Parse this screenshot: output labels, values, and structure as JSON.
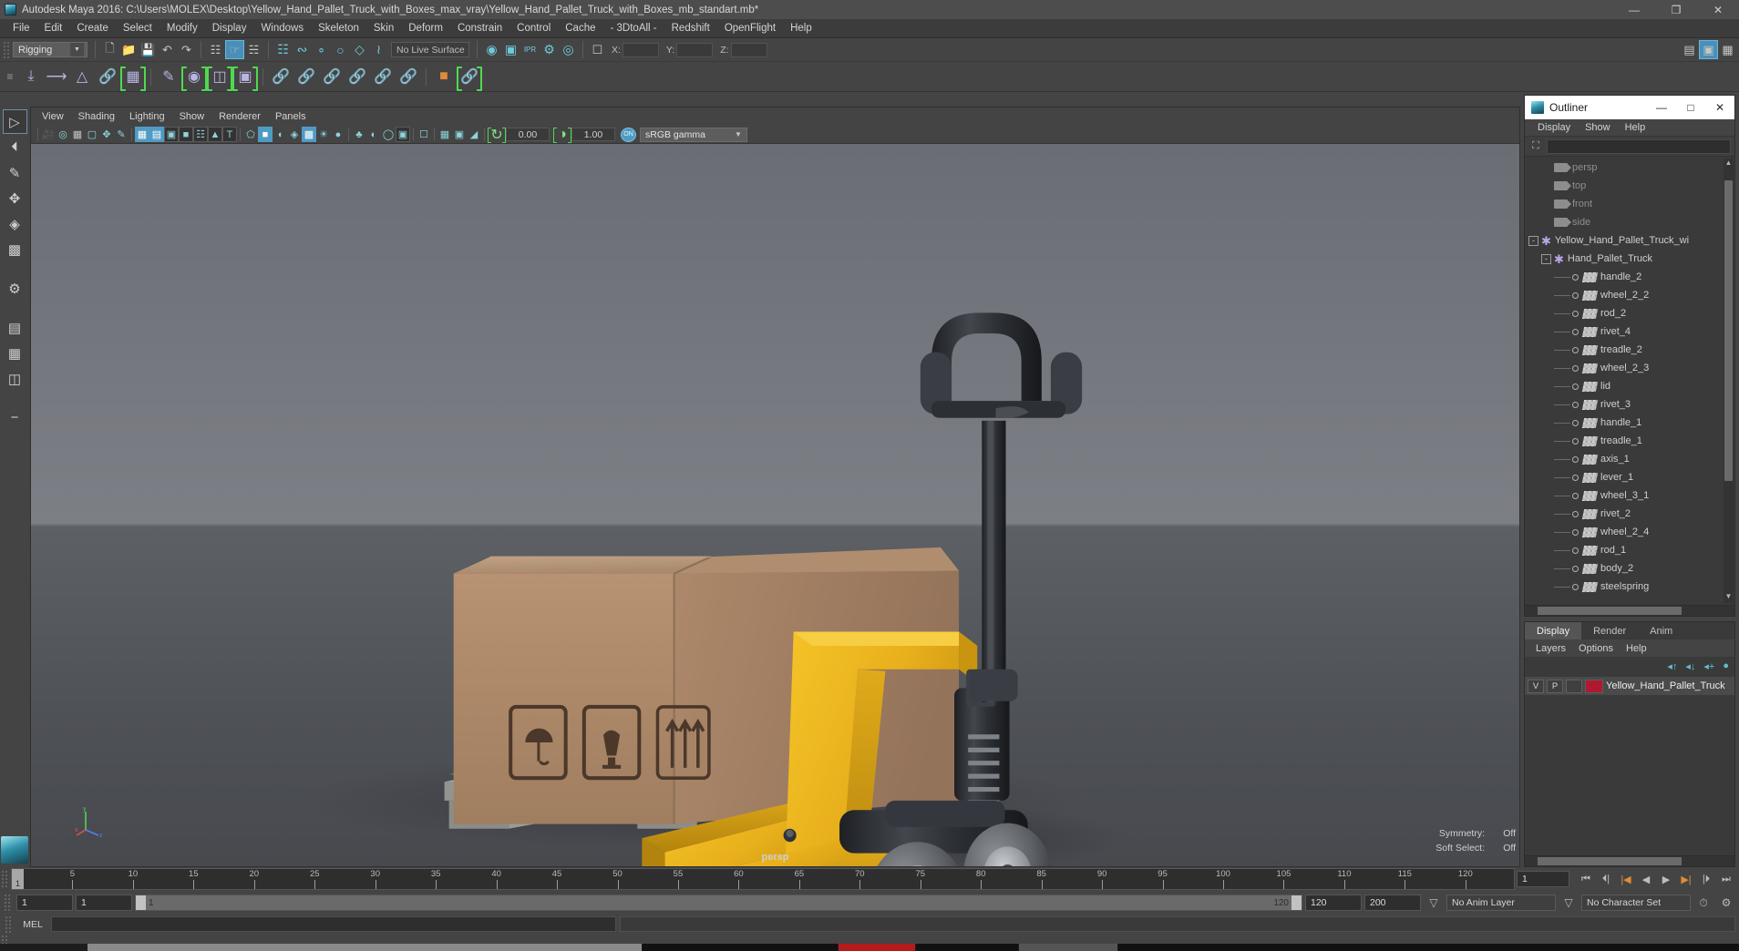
{
  "window": {
    "title": "Autodesk Maya 2016: C:\\Users\\MOLEX\\Desktop\\Yellow_Hand_Pallet_Truck_with_Boxes_max_vray\\Yellow_Hand_Pallet_Truck_with_Boxes_mb_standart.mb*",
    "minimize": "—",
    "maximize": "❐",
    "close": "✕"
  },
  "menubar": {
    "items": [
      "File",
      "Edit",
      "Create",
      "Select",
      "Modify",
      "Display",
      "Windows",
      "Skeleton",
      "Skin",
      "Deform",
      "Constrain",
      "Control",
      "Cache",
      "- 3DtoAll -",
      "Redshift",
      "OpenFlight",
      "Help"
    ]
  },
  "statusline": {
    "menu_set": "Rigging",
    "live_surface": "No Live Surface",
    "x_label": "X:",
    "y_label": "Y:",
    "z_label": "Z:",
    "x_value": "",
    "y_value": "",
    "z_value": "",
    "dropdown_arrow": "▼"
  },
  "viewport_panel": {
    "menus": [
      "View",
      "Shading",
      "Lighting",
      "Show",
      "Renderer",
      "Panels"
    ],
    "exposure_value": "0.00",
    "gamma_value": "1.00",
    "color_toggle": "ON",
    "color_profile": "sRGB gamma",
    "dropdown_arrow": "▼",
    "camera_label": "persp",
    "symmetry_label": "Symmetry:",
    "symmetry_value": "Off",
    "soft_select_label": "Soft Select:",
    "soft_select_value": "Off",
    "axis_x": "x",
    "axis_y": "y",
    "axis_z": "z"
  },
  "outliner": {
    "title": "Outliner",
    "minimize": "—",
    "maximize": "□",
    "close": "✕",
    "menus": [
      "Display",
      "Show",
      "Help"
    ],
    "search_placeholder": "",
    "search_value": "",
    "scroll_up": "▲",
    "scroll_down": "▼",
    "items": [
      {
        "name": "persp",
        "icon": "camera-icon",
        "depth": 1,
        "dim": true,
        "expander": ""
      },
      {
        "name": "top",
        "icon": "camera-icon",
        "depth": 1,
        "dim": true,
        "expander": ""
      },
      {
        "name": "front",
        "icon": "camera-icon",
        "depth": 1,
        "dim": true,
        "expander": ""
      },
      {
        "name": "side",
        "icon": "camera-icon",
        "depth": 1,
        "dim": true,
        "expander": ""
      },
      {
        "name": "Yellow_Hand_Pallet_Truck_wi",
        "icon": "group-icon",
        "depth": 0,
        "dim": false,
        "expander": "-"
      },
      {
        "name": "Hand_Pallet_Truck",
        "icon": "group-icon",
        "depth": 1,
        "dim": false,
        "expander": "-"
      },
      {
        "name": "handle_2",
        "icon": "mesh-icon",
        "depth": 2,
        "dim": false,
        "expander": ""
      },
      {
        "name": "wheel_2_2",
        "icon": "mesh-icon",
        "depth": 2,
        "dim": false,
        "expander": ""
      },
      {
        "name": "rod_2",
        "icon": "mesh-icon",
        "depth": 2,
        "dim": false,
        "expander": ""
      },
      {
        "name": "rivet_4",
        "icon": "mesh-icon",
        "depth": 2,
        "dim": false,
        "expander": ""
      },
      {
        "name": "treadle_2",
        "icon": "mesh-icon",
        "depth": 2,
        "dim": false,
        "expander": ""
      },
      {
        "name": "wheel_2_3",
        "icon": "mesh-icon",
        "depth": 2,
        "dim": false,
        "expander": ""
      },
      {
        "name": "lid",
        "icon": "mesh-icon",
        "depth": 2,
        "dim": false,
        "expander": ""
      },
      {
        "name": "rivet_3",
        "icon": "mesh-icon",
        "depth": 2,
        "dim": false,
        "expander": ""
      },
      {
        "name": "handle_1",
        "icon": "mesh-icon",
        "depth": 2,
        "dim": false,
        "expander": ""
      },
      {
        "name": "treadle_1",
        "icon": "mesh-icon",
        "depth": 2,
        "dim": false,
        "expander": ""
      },
      {
        "name": "axis_1",
        "icon": "mesh-icon",
        "depth": 2,
        "dim": false,
        "expander": ""
      },
      {
        "name": "lever_1",
        "icon": "mesh-icon",
        "depth": 2,
        "dim": false,
        "expander": ""
      },
      {
        "name": "wheel_3_1",
        "icon": "mesh-icon",
        "depth": 2,
        "dim": false,
        "expander": ""
      },
      {
        "name": "rivet_2",
        "icon": "mesh-icon",
        "depth": 2,
        "dim": false,
        "expander": ""
      },
      {
        "name": "wheel_2_4",
        "icon": "mesh-icon",
        "depth": 2,
        "dim": false,
        "expander": ""
      },
      {
        "name": "rod_1",
        "icon": "mesh-icon",
        "depth": 2,
        "dim": false,
        "expander": ""
      },
      {
        "name": "body_2",
        "icon": "mesh-icon",
        "depth": 2,
        "dim": false,
        "expander": ""
      },
      {
        "name": "steelspring",
        "icon": "mesh-icon",
        "depth": 2,
        "dim": false,
        "expander": ""
      }
    ]
  },
  "layers_panel": {
    "tabs": [
      "Display",
      "Render",
      "Anim"
    ],
    "active_tab": "Display",
    "menus": [
      "Layers",
      "Options",
      "Help"
    ],
    "rows": [
      {
        "visibility": "V",
        "playback": "P",
        "type": "",
        "color": "#b01832",
        "name": "Yellow_Hand_Pallet_Truck"
      }
    ]
  },
  "timeline": {
    "current_frame_marker": "1",
    "tick_labels": [
      "5",
      "10",
      "15",
      "20",
      "25",
      "30",
      "35",
      "40",
      "45",
      "50",
      "55",
      "60",
      "65",
      "70",
      "75",
      "80",
      "85",
      "90",
      "95",
      "100",
      "105",
      "110",
      "115",
      "120"
    ],
    "current_frame_field": "1",
    "playback_buttons": [
      "⏮",
      "⏴|",
      "|◀",
      "◀",
      "▶",
      "▶|",
      "|⏵",
      "⏭"
    ]
  },
  "range_slider": {
    "anim_start": "1",
    "playback_start": "1",
    "bar_low": "1",
    "bar_high": "120",
    "playback_end": "120",
    "anim_end": "200",
    "anim_layer": "No Anim Layer",
    "character_set": "No Character Set",
    "dropdown_arrow": "▽"
  },
  "command_line": {
    "language": "MEL",
    "input_value": "",
    "output_value": ""
  },
  "colors": {
    "accent_blue": "#4f9bc4",
    "green_bracket": "#4fd94f",
    "orange": "#e08b3a",
    "layer_color": "#b01832"
  }
}
